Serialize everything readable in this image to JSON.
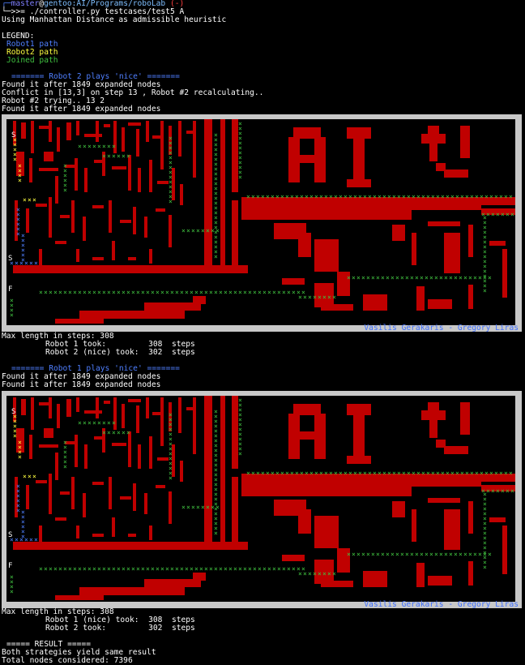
{
  "prompt": {
    "user": "master",
    "at": "@",
    "host": "gentoo",
    "path": ":AI/Programs/roboLab",
    "marker": "(-)",
    "prefix": "└─>>=",
    "command": " ./controller.py testcases/test5 A"
  },
  "heuristic_line": "Using Manhattan Distance as admissible heuristic",
  "legend": {
    "title": "LEGEND:",
    "robot1": "Robot1 path",
    "robot2": "Robot2 path",
    "joined": "Joined path"
  },
  "run1": {
    "header": "======= Robot 2 plays 'nice' =======",
    "lines": [
      "Found it after 1849 expanded nodes",
      "Conflict in [13,3] on step 13 , Robot #2 recalculating..",
      "Robot #2 trying.. 13 2",
      "Found it after 1849 expanded nodes"
    ],
    "max_length": "Max length in steps: 308",
    "robot1_took": "Robot 1 took:         308  steps",
    "robot2_took": "Robot 2 (nice) took:  302  steps"
  },
  "run2": {
    "header": "======= Robot 1 plays 'nice' =======",
    "lines": [
      "Found it after 1849 expanded nodes",
      "Found it after 1849 expanded nodes"
    ],
    "max_length": "Max length in steps: 308",
    "robot1_took": "Robot 1 (nice) took:  308  steps",
    "robot2_took": "Robot 2 took:         302  steps"
  },
  "result": {
    "header": "===== RESULT =====",
    "line1": "Both strategies yield same result",
    "line2": "Total nodes considered: 7396"
  },
  "maze": {
    "credit": "Vasilis Gerakaris - Gregory Liras",
    "start_label": "S",
    "finish_label": "F",
    "path_glyph": "×",
    "colors": {
      "wall": "#c00000",
      "border": "#c8c8c8",
      "robot1": "#4f7fff",
      "robot2": "#ffff40",
      "joined": "#40c040"
    }
  }
}
